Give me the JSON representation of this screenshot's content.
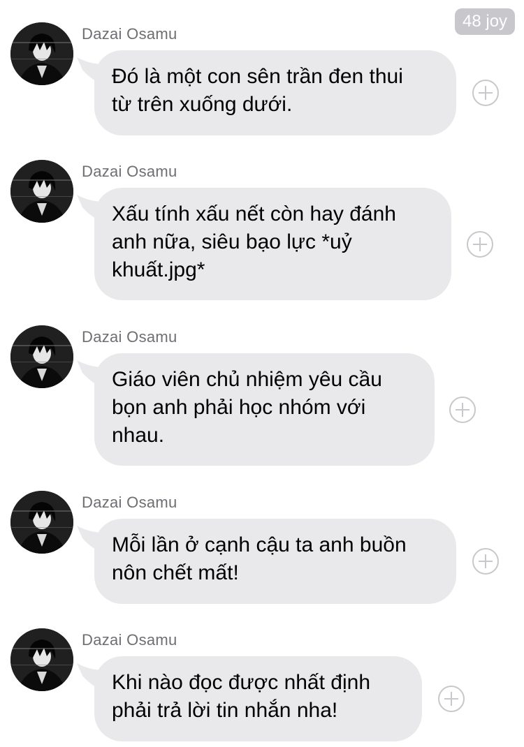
{
  "header": {
    "count_badge": "48 joy"
  },
  "messages": [
    {
      "sender": "Dazai Osamu",
      "text": "Đó là một con sên trần đen thui\ntừ trên xuống dưới."
    },
    {
      "sender": "Dazai Osamu",
      "text": "Xấu tính xấu nết còn hay đánh\nanh nữa, siêu bạo lực *uỷ\nkhuất.jpg*"
    },
    {
      "sender": "Dazai Osamu",
      "text": "Giáo viên chủ nhiệm yêu cầu\nbọn anh phải học nhóm với\nnhau."
    },
    {
      "sender": "Dazai Osamu",
      "text": "Mỗi lần ở cạnh cậu ta anh buồn\nnôn chết mất!"
    },
    {
      "sender": "Dazai Osamu",
      "text": "Khi nào đọc được nhất định\nphải trả lời tin nhắn nha!"
    }
  ],
  "colors": {
    "bubble": "#e9e9eb",
    "name": "#6e6e73",
    "badge": "#c7c7cc",
    "plus_icon": "#c8c8cc"
  },
  "icons": {
    "avatar": "anime-character-avatar",
    "reaction": "add-reaction-plus-icon"
  }
}
